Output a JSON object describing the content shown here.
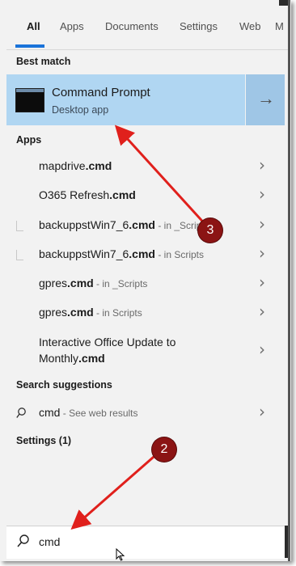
{
  "tabs": {
    "all": "All",
    "apps": "Apps",
    "documents": "Documents",
    "settings": "Settings",
    "web": "Web",
    "more": "M"
  },
  "best_match": {
    "heading": "Best match",
    "title": "Command Prompt",
    "subtitle": "Desktop app",
    "arrow_icon": "arrow-right-icon"
  },
  "apps": {
    "heading": "Apps",
    "items": [
      {
        "name": "mapdrive",
        "ext": ".cmd",
        "loc": ""
      },
      {
        "name": "O365 Refresh",
        "ext": ".cmd",
        "loc": ""
      },
      {
        "name": "backuppstWin7_6",
        "ext": ".cmd",
        "loc": " - in _Scripts"
      },
      {
        "name": "backuppstWin7_6",
        "ext": ".cmd",
        "loc": " - in Scripts"
      },
      {
        "name": "gpres",
        "ext": ".cmd",
        "loc": " - in _Scripts"
      },
      {
        "name": "gpres",
        "ext": ".cmd",
        "loc": " - in Scripts"
      },
      {
        "name_line1": "Interactive Office Update to",
        "name_line2": "Monthly",
        "ext": ".cmd"
      }
    ]
  },
  "search_suggestions": {
    "heading": "Search suggestions",
    "query": "cmd",
    "suffix": " - See web results"
  },
  "settings_heading": "Settings (1)",
  "search_box": {
    "value": "cmd"
  },
  "annotations": {
    "badge_2": "2",
    "badge_3": "3",
    "arrow_color": "#e0201c",
    "badge_color": "#8b1414"
  },
  "colors": {
    "accent": "#1a73d9",
    "selected_bg": "#b0d6f2"
  }
}
